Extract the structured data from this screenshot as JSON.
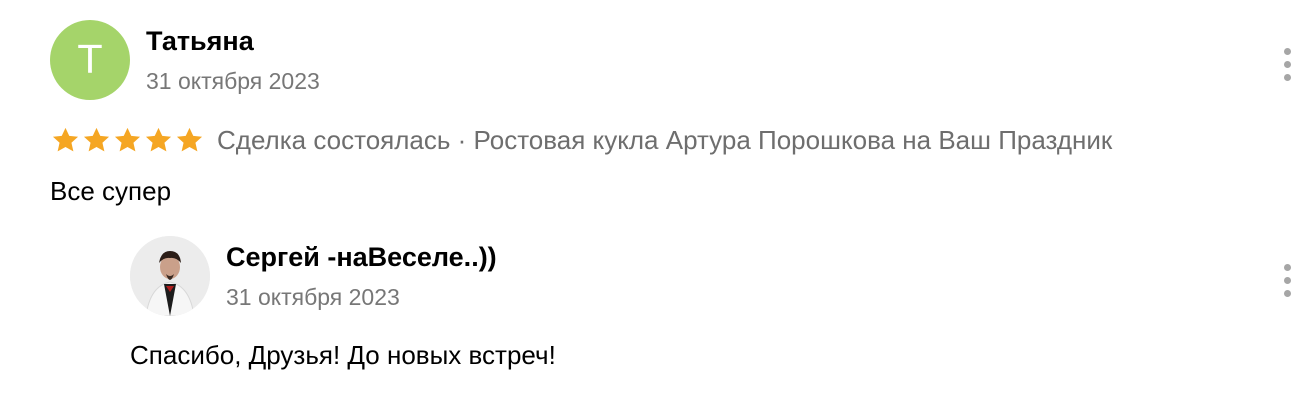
{
  "colors": {
    "avatar_bg": "#a5d46a",
    "star": "#f5a623",
    "muted_text": "#6e6e6e",
    "date_text": "#777777",
    "menu_dots": "#a6a6a6"
  },
  "review": {
    "author_initial": "Т",
    "author_name": "Татьяна",
    "date": "31 октября 2023",
    "rating": 5,
    "rating_max": 5,
    "meta": "Сделка состоялась · Ростовая кукла Артура Порошкова на Ваш Праздник",
    "text": "Все супер",
    "menu_icon": "more-vertical-icon"
  },
  "reply": {
    "author_name": "Сергей -наВеселе..))",
    "date": "31 октября 2023",
    "text": "Спасибо, Друзья! До новых встреч!",
    "avatar_icon": "user-photo",
    "menu_icon": "more-vertical-icon"
  }
}
